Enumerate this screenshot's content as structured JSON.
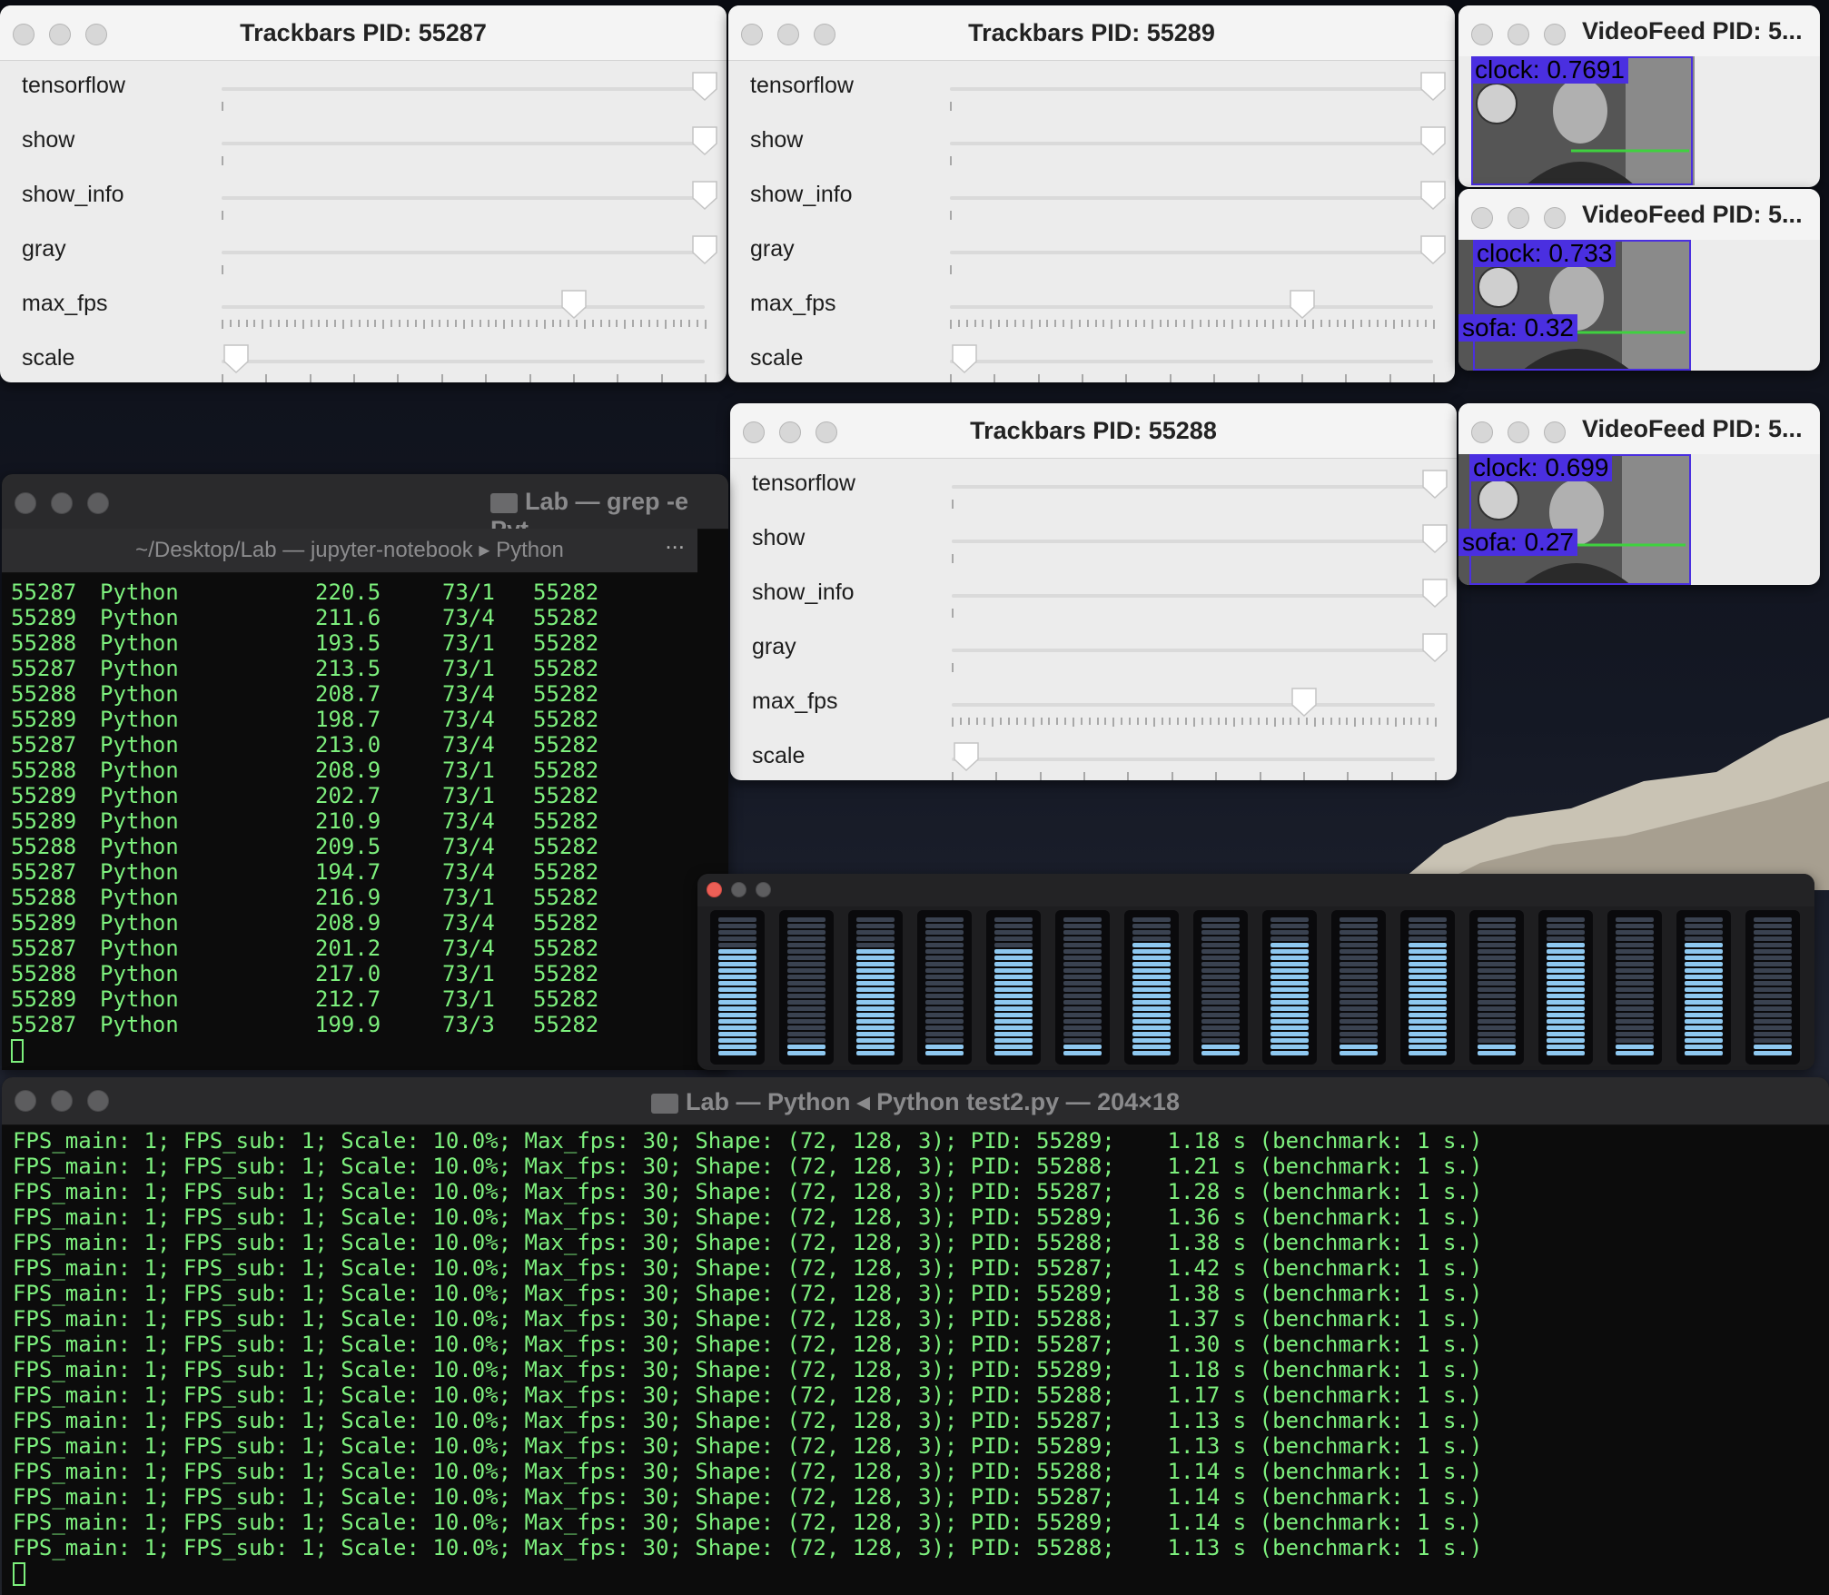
{
  "trackbars": [
    {
      "title": "Trackbars PID: 55287",
      "sliders": [
        {
          "label": "tensorflow",
          "value_pct": 100
        },
        {
          "label": "show",
          "value_pct": 100
        },
        {
          "label": "show_info",
          "value_pct": 100
        },
        {
          "label": "gray",
          "value_pct": 100
        },
        {
          "label": "max_fps",
          "value_pct": 73
        },
        {
          "label": "scale",
          "value_pct": 3
        }
      ]
    },
    {
      "title": "Trackbars PID: 55289",
      "sliders": [
        {
          "label": "tensorflow",
          "value_pct": 100
        },
        {
          "label": "show",
          "value_pct": 100
        },
        {
          "label": "show_info",
          "value_pct": 100
        },
        {
          "label": "gray",
          "value_pct": 100
        },
        {
          "label": "max_fps",
          "value_pct": 73
        },
        {
          "label": "scale",
          "value_pct": 3
        }
      ]
    },
    {
      "title": "Trackbars PID: 55288",
      "sliders": [
        {
          "label": "tensorflow",
          "value_pct": 100
        },
        {
          "label": "show",
          "value_pct": 100
        },
        {
          "label": "show_info",
          "value_pct": 100
        },
        {
          "label": "gray",
          "value_pct": 100
        },
        {
          "label": "max_fps",
          "value_pct": 73
        },
        {
          "label": "scale",
          "value_pct": 3
        }
      ]
    }
  ],
  "videofeeds": [
    {
      "title": "VideoFeed PID: 5...",
      "labels": [
        "clock: 0.7691"
      ]
    },
    {
      "title": "VideoFeed PID: 5...",
      "labels": [
        "clock: 0.733",
        "sofa: 0.32"
      ]
    },
    {
      "title": "VideoFeed PID: 5...",
      "labels": [
        "clock: 0.699",
        "sofa: 0.27"
      ]
    }
  ],
  "terminal1": {
    "title": "Lab — grep -e Pyt",
    "tab": "~/Desktop/Lab — jupyter-notebook ▸ Python",
    "tab_more": "...",
    "rows": [
      [
        "55287",
        "Python",
        "220.5",
        "73/1",
        "55282"
      ],
      [
        "55289",
        "Python",
        "211.6",
        "73/4",
        "55282"
      ],
      [
        "55288",
        "Python",
        "193.5",
        "73/1",
        "55282"
      ],
      [
        "55287",
        "Python",
        "213.5",
        "73/1",
        "55282"
      ],
      [
        "55288",
        "Python",
        "208.7",
        "73/4",
        "55282"
      ],
      [
        "55289",
        "Python",
        "198.7",
        "73/4",
        "55282"
      ],
      [
        "55287",
        "Python",
        "213.0",
        "73/4",
        "55282"
      ],
      [
        "55288",
        "Python",
        "208.9",
        "73/1",
        "55282"
      ],
      [
        "55289",
        "Python",
        "202.7",
        "73/1",
        "55282"
      ],
      [
        "55289",
        "Python",
        "210.9",
        "73/4",
        "55282"
      ],
      [
        "55288",
        "Python",
        "209.5",
        "73/4",
        "55282"
      ],
      [
        "55287",
        "Python",
        "194.7",
        "73/4",
        "55282"
      ],
      [
        "55288",
        "Python",
        "216.9",
        "73/1",
        "55282"
      ],
      [
        "55289",
        "Python",
        "208.9",
        "73/4",
        "55282"
      ],
      [
        "55287",
        "Python",
        "201.2",
        "73/4",
        "55282"
      ],
      [
        "55288",
        "Python",
        "217.0",
        "73/1",
        "55282"
      ],
      [
        "55289",
        "Python",
        "212.7",
        "73/1",
        "55282"
      ],
      [
        "55287",
        "Python",
        "199.9",
        "73/3",
        "55282"
      ]
    ]
  },
  "terminal2": {
    "title": "Lab — Python ◂ Python test2.py — 204×18",
    "lines": [
      "FPS_main: 1; FPS_sub: 1; Scale: 10.0%; Max_fps: 30; Shape: (72, 128, 3); PID: 55289;    1.18 s (benchmark: 1 s.)",
      "FPS_main: 1; FPS_sub: 1; Scale: 10.0%; Max_fps: 30; Shape: (72, 128, 3); PID: 55288;    1.21 s (benchmark: 1 s.)",
      "FPS_main: 1; FPS_sub: 1; Scale: 10.0%; Max_fps: 30; Shape: (72, 128, 3); PID: 55287;    1.28 s (benchmark: 1 s.)",
      "FPS_main: 1; FPS_sub: 1; Scale: 10.0%; Max_fps: 30; Shape: (72, 128, 3); PID: 55289;    1.36 s (benchmark: 1 s.)",
      "FPS_main: 1; FPS_sub: 1; Scale: 10.0%; Max_fps: 30; Shape: (72, 128, 3); PID: 55288;    1.38 s (benchmark: 1 s.)",
      "FPS_main: 1; FPS_sub: 1; Scale: 10.0%; Max_fps: 30; Shape: (72, 128, 3); PID: 55287;    1.42 s (benchmark: 1 s.)",
      "FPS_main: 1; FPS_sub: 1; Scale: 10.0%; Max_fps: 30; Shape: (72, 128, 3); PID: 55289;    1.38 s (benchmark: 1 s.)",
      "FPS_main: 1; FPS_sub: 1; Scale: 10.0%; Max_fps: 30; Shape: (72, 128, 3); PID: 55288;    1.37 s (benchmark: 1 s.)",
      "FPS_main: 1; FPS_sub: 1; Scale: 10.0%; Max_fps: 30; Shape: (72, 128, 3); PID: 55287;    1.30 s (benchmark: 1 s.)",
      "FPS_main: 1; FPS_sub: 1; Scale: 10.0%; Max_fps: 30; Shape: (72, 128, 3); PID: 55289;    1.18 s (benchmark: 1 s.)",
      "FPS_main: 1; FPS_sub: 1; Scale: 10.0%; Max_fps: 30; Shape: (72, 128, 3); PID: 55288;    1.17 s (benchmark: 1 s.)",
      "FPS_main: 1; FPS_sub: 1; Scale: 10.0%; Max_fps: 30; Shape: (72, 128, 3); PID: 55287;    1.13 s (benchmark: 1 s.)",
      "FPS_main: 1; FPS_sub: 1; Scale: 10.0%; Max_fps: 30; Shape: (72, 128, 3); PID: 55289;    1.13 s (benchmark: 1 s.)",
      "FPS_main: 1; FPS_sub: 1; Scale: 10.0%; Max_fps: 30; Shape: (72, 128, 3); PID: 55288;    1.14 s (benchmark: 1 s.)",
      "FPS_main: 1; FPS_sub: 1; Scale: 10.0%; Max_fps: 30; Shape: (72, 128, 3); PID: 55287;    1.14 s (benchmark: 1 s.)",
      "FPS_main: 1; FPS_sub: 1; Scale: 10.0%; Max_fps: 30; Shape: (72, 128, 3); PID: 55289;    1.14 s (benchmark: 1 s.)",
      "FPS_main: 1; FPS_sub: 1; Scale: 10.0%; Max_fps: 30; Shape: (72, 128, 3); PID: 55288;    1.13 s (benchmark: 1 s.)"
    ]
  },
  "cpu_meter": {
    "levels": [
      0.75,
      0.08,
      0.75,
      0.08,
      0.75,
      0.08,
      0.8,
      0.08,
      0.8,
      0.08,
      0.8,
      0.08,
      0.8,
      0.08,
      0.8,
      0.08
    ],
    "lit_color": "#8ec8f0",
    "dim_color": "#3a4250"
  },
  "colors": {
    "terminal_text": "#7df07d",
    "detection_box": "#4a2fe0",
    "detection_line": "#3fd13f"
  }
}
